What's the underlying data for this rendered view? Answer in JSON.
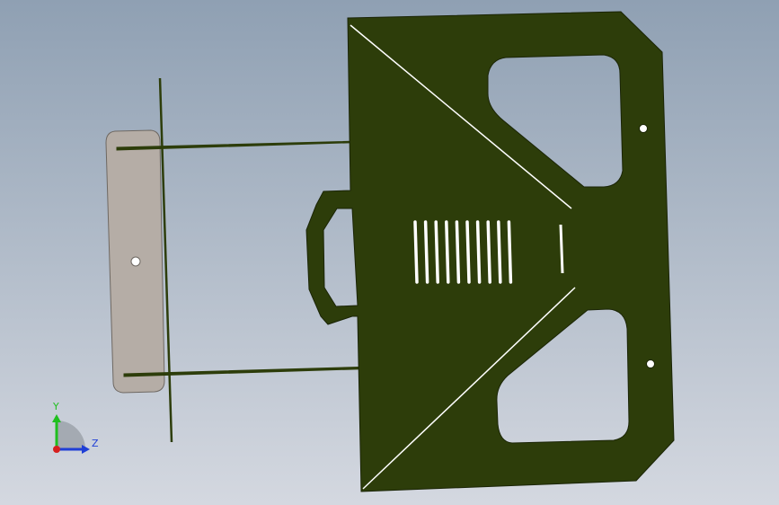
{
  "viewport": {
    "background_top": "#8fa0b3",
    "background_bottom": "#d4d8e0"
  },
  "model": {
    "main_plate_color": "#2d3d0a",
    "main_plate_edge": "#1a2406",
    "bracket_color": "#b5ada6",
    "bracket_edge": "#6e6862",
    "rod_color": "#2d3d0a",
    "hole_color": "#ffffff"
  },
  "triad": {
    "y_label": "Y",
    "z_label": "Z",
    "y_color": "#1fbf1f",
    "z_color": "#1f3fd6",
    "x_color": "#d61f1f"
  }
}
